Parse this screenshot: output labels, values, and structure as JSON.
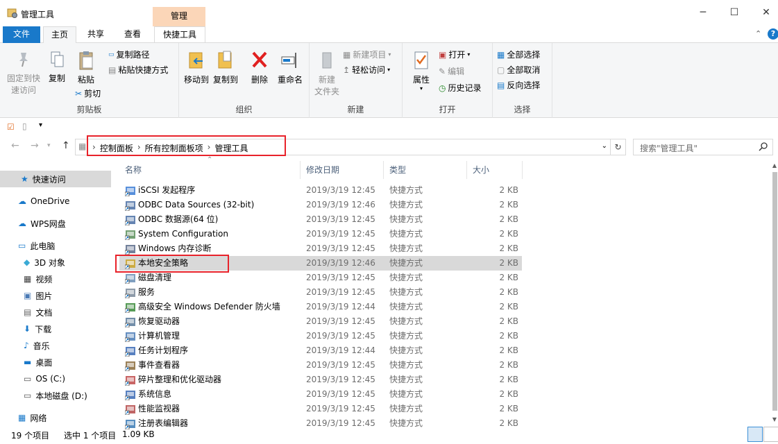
{
  "window": {
    "title": "管理工具",
    "context_tab_header": "管理",
    "controls": {
      "minimize": "─",
      "maximize": "☐",
      "close": "✕"
    }
  },
  "ribbon_tabs": {
    "file": "文件",
    "home": "主页",
    "share": "共享",
    "view": "查看",
    "manage": "快捷工具"
  },
  "ribbon": {
    "clipboard": {
      "label": "剪贴板",
      "pin": "固定到快速访问",
      "pin_line1": "固定到快",
      "pin_line2": "速访问",
      "copy": "复制",
      "paste": "粘贴",
      "copy_path": "复制路径",
      "paste_shortcut": "粘贴快捷方式",
      "cut": "剪切"
    },
    "organize": {
      "label": "组织",
      "move_to": "移动到",
      "copy_to": "复制到",
      "delete": "删除",
      "rename": "重命名"
    },
    "new": {
      "label": "新建",
      "new_folder_line1": "新建",
      "new_folder_line2": "文件夹",
      "new_item": "新建项目",
      "easy_access": "轻松访问"
    },
    "open": {
      "label": "打开",
      "properties": "属性",
      "open": "打开",
      "edit": "编辑",
      "history": "历史记录"
    },
    "select": {
      "label": "选择",
      "select_all": "全部选择",
      "select_none": "全部取消",
      "invert": "反向选择"
    }
  },
  "address": {
    "crumbs": [
      "控制面板",
      "所有控制面板项",
      "管理工具"
    ],
    "search_placeholder": "搜索\"管理工具\""
  },
  "nav": {
    "quick_access": "快速访问",
    "onedrive": "OneDrive",
    "wps": "WPS网盘",
    "this_pc": "此电脑",
    "objects3d": "3D 对象",
    "videos": "视频",
    "pictures": "图片",
    "documents": "文档",
    "downloads": "下载",
    "music": "音乐",
    "desktop": "桌面",
    "os_c": "OS (C:)",
    "local_d": "本地磁盘 (D:)",
    "network": "网络"
  },
  "columns": {
    "name": "名称",
    "date": "修改日期",
    "type": "类型",
    "size": "大小"
  },
  "files": [
    {
      "name": "iSCSI 发起程序",
      "date": "2019/3/19 12:45",
      "type": "快捷方式",
      "size": "2 KB",
      "icon": "iscsi-icon",
      "color": "#3a7bd5"
    },
    {
      "name": "ODBC Data Sources (32-bit)",
      "date": "2019/3/19 12:46",
      "type": "快捷方式",
      "size": "2 KB",
      "icon": "odbc-icon",
      "color": "#4a6fa5"
    },
    {
      "name": "ODBC 数据源(64 位)",
      "date": "2019/3/19 12:45",
      "type": "快捷方式",
      "size": "2 KB",
      "icon": "odbc-icon",
      "color": "#4a6fa5"
    },
    {
      "name": "System Configuration",
      "date": "2019/3/19 12:45",
      "type": "快捷方式",
      "size": "2 KB",
      "icon": "sysconfig-icon",
      "color": "#5a8f5a"
    },
    {
      "name": "Windows 内存诊断",
      "date": "2019/3/19 12:45",
      "type": "快捷方式",
      "size": "2 KB",
      "icon": "memory-diag-icon",
      "color": "#5a6b8a"
    },
    {
      "name": "本地安全策略",
      "date": "2019/3/19 12:46",
      "type": "快捷方式",
      "size": "2 KB",
      "icon": "security-policy-icon",
      "color": "#c9a227"
    },
    {
      "name": "磁盘清理",
      "date": "2019/3/19 12:45",
      "type": "快捷方式",
      "size": "2 KB",
      "icon": "disk-cleanup-icon",
      "color": "#6a8fb5"
    },
    {
      "name": "服务",
      "date": "2019/3/19 12:45",
      "type": "快捷方式",
      "size": "2 KB",
      "icon": "services-icon",
      "color": "#7a8a9a"
    },
    {
      "name": "高级安全 Windows Defender 防火墙",
      "date": "2019/3/19 12:44",
      "type": "快捷方式",
      "size": "2 KB",
      "icon": "firewall-icon",
      "color": "#3a8a3a"
    },
    {
      "name": "恢复驱动器",
      "date": "2019/3/19 12:45",
      "type": "快捷方式",
      "size": "2 KB",
      "icon": "recovery-drive-icon",
      "color": "#5a7a9a"
    },
    {
      "name": "计算机管理",
      "date": "2019/3/19 12:45",
      "type": "快捷方式",
      "size": "2 KB",
      "icon": "computer-mgmt-icon",
      "color": "#4a7ab5"
    },
    {
      "name": "任务计划程序",
      "date": "2019/3/19 12:44",
      "type": "快捷方式",
      "size": "2 KB",
      "icon": "task-scheduler-icon",
      "color": "#3a6ab5"
    },
    {
      "name": "事件查看器",
      "date": "2019/3/19 12:45",
      "type": "快捷方式",
      "size": "2 KB",
      "icon": "event-viewer-icon",
      "color": "#8a6a3a"
    },
    {
      "name": "碎片整理和优化驱动器",
      "date": "2019/3/19 12:45",
      "type": "快捷方式",
      "size": "2 KB",
      "icon": "defrag-icon",
      "color": "#c04a4a"
    },
    {
      "name": "系统信息",
      "date": "2019/3/19 12:45",
      "type": "快捷方式",
      "size": "2 KB",
      "icon": "sysinfo-icon",
      "color": "#3a6ab5"
    },
    {
      "name": "性能监视器",
      "date": "2019/3/19 12:45",
      "type": "快捷方式",
      "size": "2 KB",
      "icon": "perfmon-icon",
      "color": "#b54a4a"
    },
    {
      "name": "注册表编辑器",
      "date": "2019/3/19 12:45",
      "type": "快捷方式",
      "size": "2 KB",
      "icon": "regedit-icon",
      "color": "#3a7ab5"
    }
  ],
  "status": {
    "count": "19 个项目",
    "selected": "选中 1 个项目",
    "size": "1.09 KB"
  },
  "colors": {
    "accent": "#1979ca",
    "context_tab": "#fbd6b8",
    "highlight_box": "#e8222a",
    "selection": "#d9d9d9"
  }
}
